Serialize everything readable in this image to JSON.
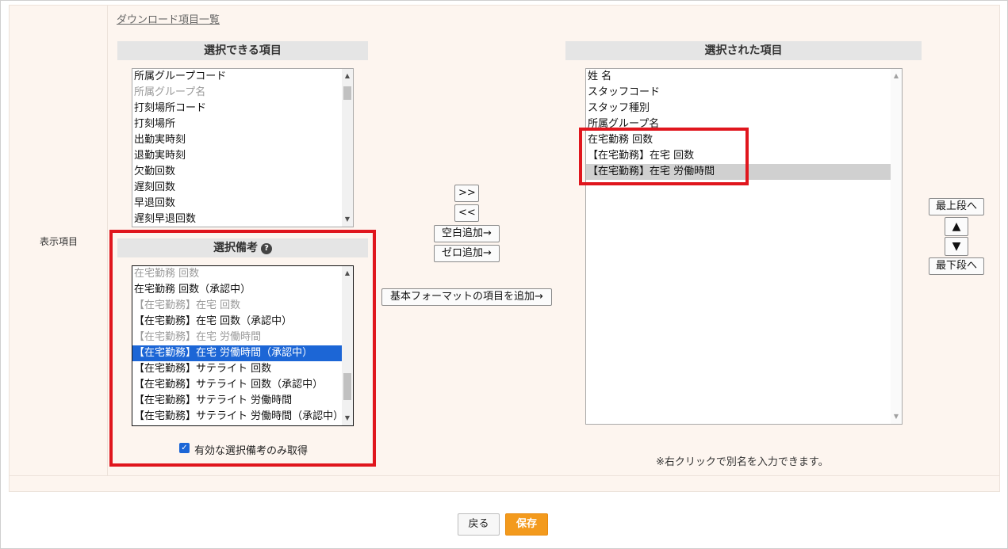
{
  "download_link": "ダウンロード項目一覧",
  "row_label": "表示項目",
  "available": {
    "header": "選択できる項目",
    "items": [
      "所属グループコード",
      "所属グループ名",
      "打刻場所コード",
      "打刻場所",
      "出勤実時刻",
      "退勤実時刻",
      "欠勤回数",
      "遅刻回数",
      "早退回数",
      "遅刻早退回数"
    ]
  },
  "remarks": {
    "header": "選択備考",
    "help_icon": "?",
    "items": [
      "在宅勤務 回数",
      "在宅勤務 回数（承認中）",
      "【在宅勤務】在宅 回数",
      "【在宅勤務】在宅 回数（承認中）",
      "【在宅勤務】在宅 労働時間",
      "【在宅勤務】在宅 労働時間（承認中）",
      "【在宅勤務】サテライト 回数",
      "【在宅勤務】サテライト 回数（承認中）",
      "【在宅勤務】サテライト 労働時間",
      "【在宅勤務】サテライト 労働時間（承認中）"
    ],
    "checkbox_label": "有効な選択備考のみ取得",
    "checkbox_checked": true
  },
  "middle_buttons": {
    "add": ">>",
    "remove": "<<",
    "add_blank": "空白追加→",
    "add_zero": "ゼロ追加→",
    "add_basic_format": "基本フォーマットの項目を追加→"
  },
  "selected": {
    "header": "選択された項目",
    "items": [
      "姓 名",
      "スタッフコード",
      "スタッフ種別",
      "所属グループ名",
      "在宅勤務 回数",
      "【在宅勤務】在宅 回数",
      "【在宅勤務】在宅 労働時間"
    ]
  },
  "order_buttons": {
    "top": "最上段へ",
    "up": "▲",
    "down": "▼",
    "bottom": "最下段へ"
  },
  "note": "※右クリックで別名を入力できます。",
  "footer": {
    "back": "戻る",
    "save": "保存"
  },
  "colors": {
    "panel_bg": "#fdf5ef",
    "highlight_border": "#e0161d",
    "selection_blue": "#1c66d6",
    "save_orange": "#f39a1d"
  }
}
